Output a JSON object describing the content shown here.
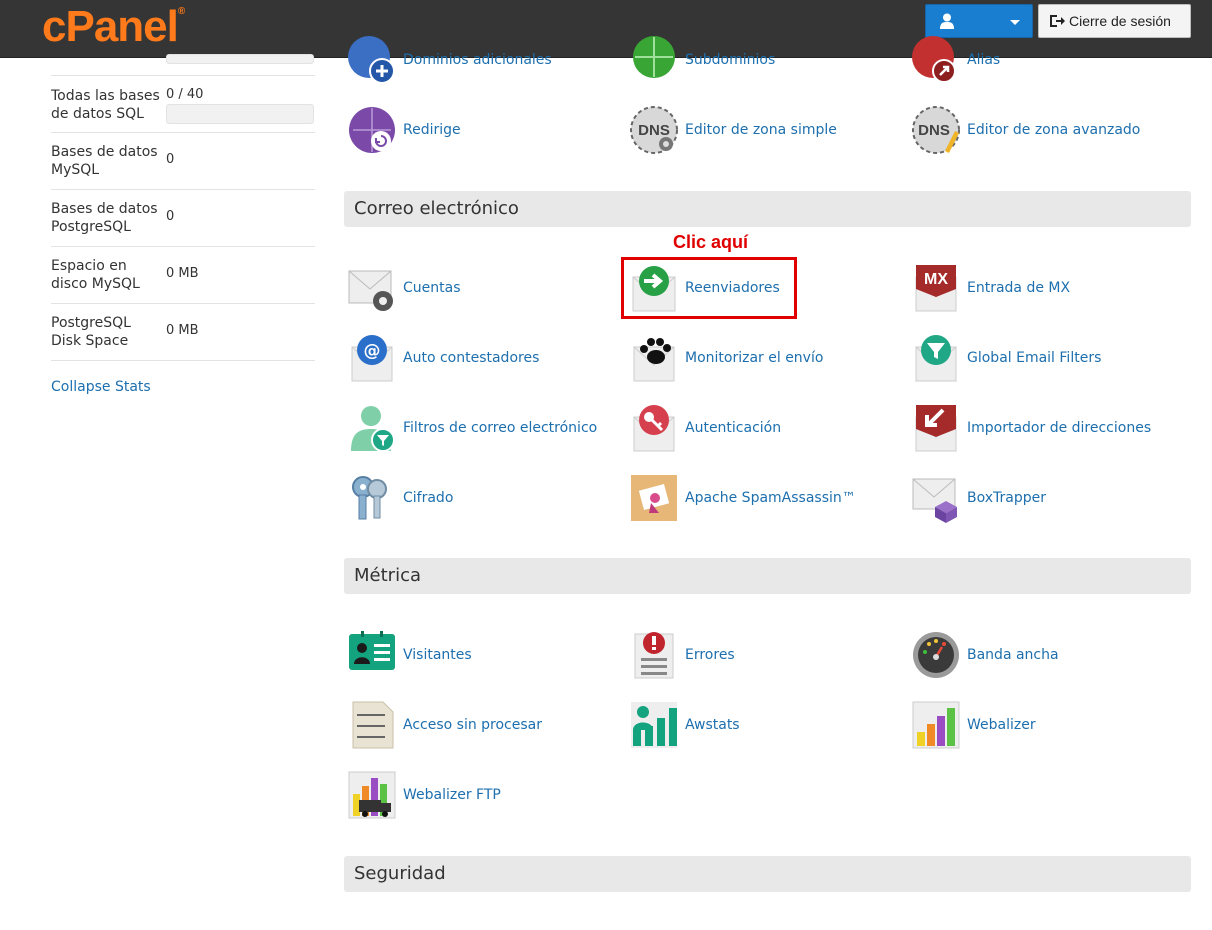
{
  "brand": {
    "logo": "cPanel",
    "trademark": "®"
  },
  "topbar": {
    "logout_label": "Cierre de sesión"
  },
  "stats": [
    {
      "label": "Todas las bases de datos SQL",
      "value": "0 / 40",
      "has_bar": true
    },
    {
      "label": "Bases de datos MySQL",
      "value": "0"
    },
    {
      "label": "Bases de datos PostgreSQL",
      "value": "0"
    },
    {
      "label": "Espacio en disco MySQL",
      "value": "0 MB"
    },
    {
      "label": "PostgreSQL Disk Space",
      "value": "0 MB"
    }
  ],
  "collapse_label": "Collapse Stats",
  "domains": {
    "top_row": [
      "Dominios adicionales",
      "Subdominios",
      "Alias"
    ],
    "row2": [
      "Redirige",
      "Editor de zona simple",
      "Editor de zona avanzado"
    ]
  },
  "email": {
    "title": "Correo electrónico",
    "annotation": "Clic aquí",
    "tools": [
      "Cuentas",
      "Reenviadores",
      "Entrada de MX",
      "Auto contestadores",
      "Monitorizar el envío",
      "Global Email Filters",
      "Filtros de correo electrónico",
      "Autenticación",
      "Importador de direcciones",
      "Cifrado",
      "Apache SpamAssassin™",
      "BoxTrapper"
    ]
  },
  "metrics": {
    "title": "Métrica",
    "tools": [
      "Visitantes",
      "Errores",
      "Banda ancha",
      "Acceso sin procesar",
      "Awstats",
      "Webalizer",
      "Webalizer FTP"
    ]
  },
  "security": {
    "title": "Seguridad"
  },
  "colors": {
    "accent": "#1d6fae",
    "logo": "#ff7a1a",
    "topbar": "#353535",
    "highlight": "#e00000"
  }
}
